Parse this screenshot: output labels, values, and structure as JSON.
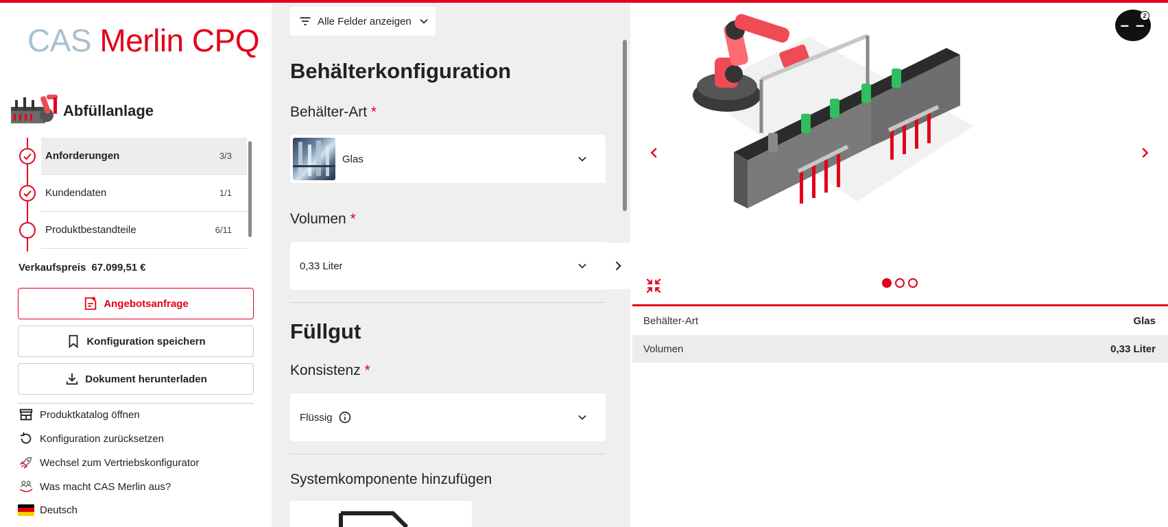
{
  "brand": {
    "part1": "CAS",
    "part2": "Merlin CPQ"
  },
  "product": {
    "title": "Abfüllanlage"
  },
  "steps": [
    {
      "label": "Anforderungen",
      "count": "3/3"
    },
    {
      "label": "Kundendaten",
      "count": "1/1"
    },
    {
      "label": "Produktbestandteile",
      "count": "6/11"
    }
  ],
  "price": {
    "label": "Verkaufspreis",
    "value": "67.099,51 €"
  },
  "buttons": {
    "offer": "Angebotsanfrage",
    "save": "Konfiguration speichern",
    "download": "Dokument herunterladen"
  },
  "links": {
    "catalog": "Produktkatalog öffnen",
    "reset": "Konfiguration zurücksetzen",
    "switch": "Wechsel zum Vertriebskonfigurator",
    "about": "Was macht CAS Merlin aus?",
    "language": "Deutsch"
  },
  "form": {
    "filter_label": "Alle Felder anzeigen",
    "section1": "Behälterkonfiguration",
    "container_type_label": "Behälter-Art",
    "container_type_value": "Glas",
    "volume_label": "Volumen",
    "volume_value": "0,33 Liter",
    "section2": "Füllgut",
    "consistency_label": "Konsistenz",
    "consistency_value": "Flüssig",
    "add_component": "Systemkomponente hinzufügen",
    "required_mark": "*"
  },
  "avatar": {
    "initials": "– –",
    "badge": "2"
  },
  "summary": [
    {
      "label": "Behälter-Art",
      "value": "Glas"
    },
    {
      "label": "Volumen",
      "value": "0,33 Liter"
    }
  ],
  "carousel": {
    "slides": 3,
    "active": 0
  },
  "colors": {
    "accent": "#e2001a",
    "logo_gray": "#a9c0cf",
    "panel_bg": "#efefef"
  }
}
